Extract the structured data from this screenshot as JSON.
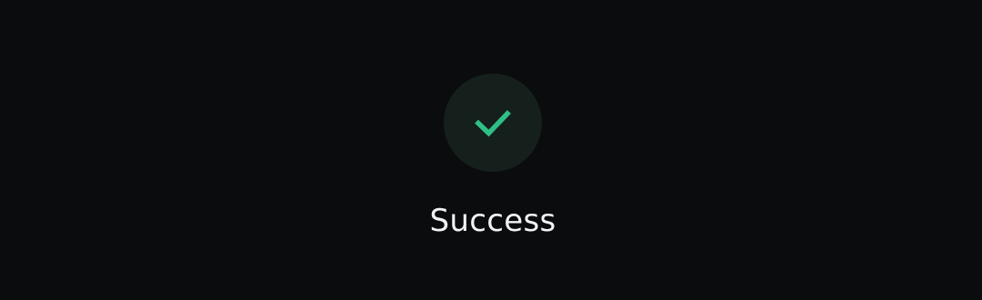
{
  "status": {
    "label": "Success",
    "icon": "checkmark-icon",
    "icon_color": "#2fbf87",
    "circle_color": "#15201c"
  },
  "background_color": "#0b0c0e"
}
